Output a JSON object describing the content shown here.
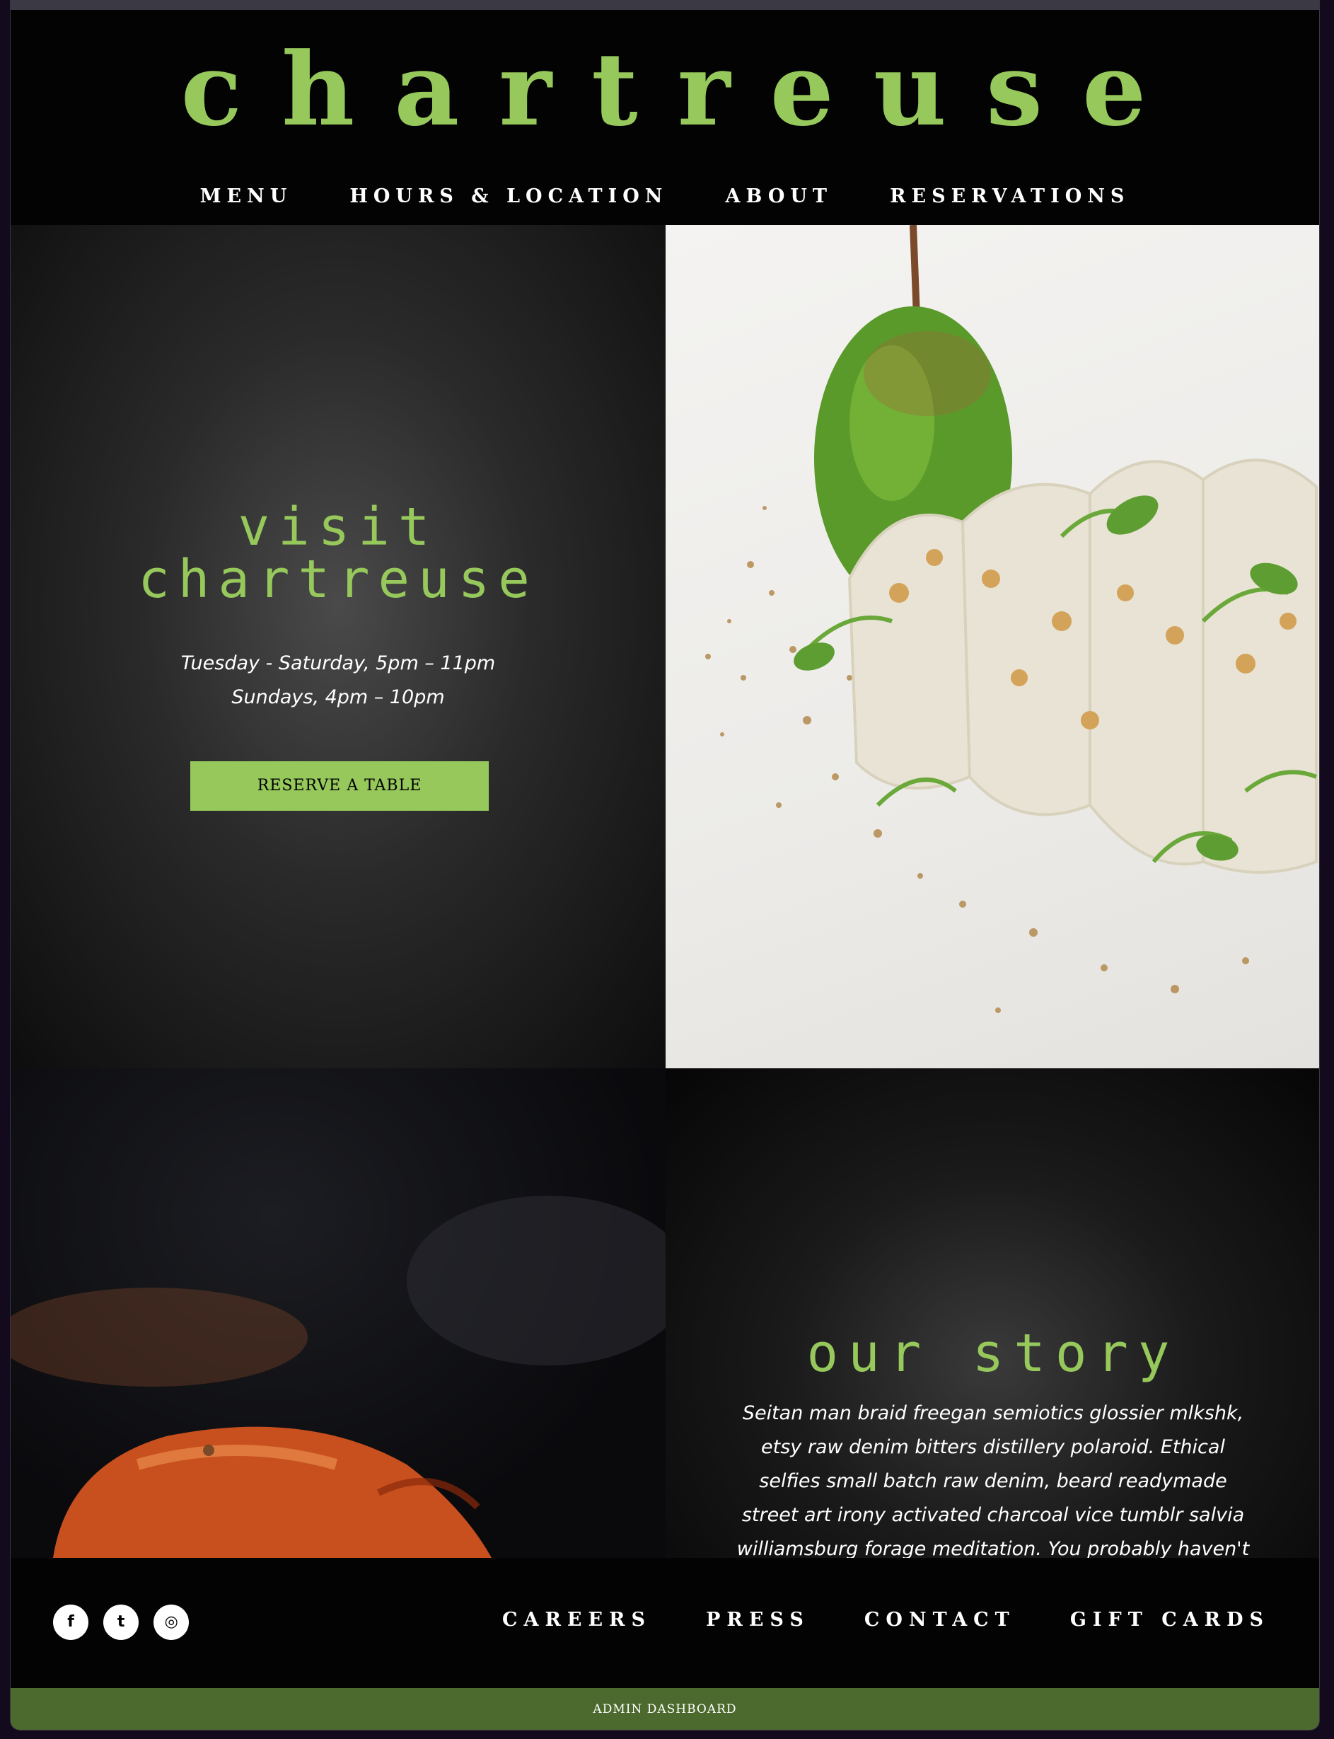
{
  "brand": {
    "logo": "chartreuse",
    "accent": "#96c85b"
  },
  "nav": {
    "items": [
      {
        "label": "MENU"
      },
      {
        "label": "HOURS & LOCATION"
      },
      {
        "label": "ABOUT"
      },
      {
        "label": "RESERVATIONS"
      }
    ]
  },
  "visit": {
    "title_line1": "visit",
    "title_line2": "chartreuse",
    "hours_line1": "Tuesday - Saturday, 5pm – 11pm",
    "hours_line2": "Sundays, 4pm – 10pm",
    "cta": "RESERVE A TABLE"
  },
  "story": {
    "title": "our story",
    "text": "Seitan man braid freegan semiotics glossier mlkshk, etsy raw denim bitters distillery polaroid. Ethical selfies small batch raw denim, beard readymade street art irony activated charcoal vice tumblr salvia williamsburg forage meditation. You probably haven't"
  },
  "footer": {
    "social": [
      {
        "icon": "facebook-icon",
        "glyph": "f"
      },
      {
        "icon": "twitter-icon",
        "glyph": "t"
      },
      {
        "icon": "instagram-icon",
        "glyph": "◎"
      }
    ],
    "links": [
      {
        "label": "CAREERS"
      },
      {
        "label": "PRESS"
      },
      {
        "label": "CONTACT"
      },
      {
        "label": "GIFT CARDS"
      }
    ]
  },
  "admin": {
    "label": "ADMIN DASHBOARD"
  }
}
